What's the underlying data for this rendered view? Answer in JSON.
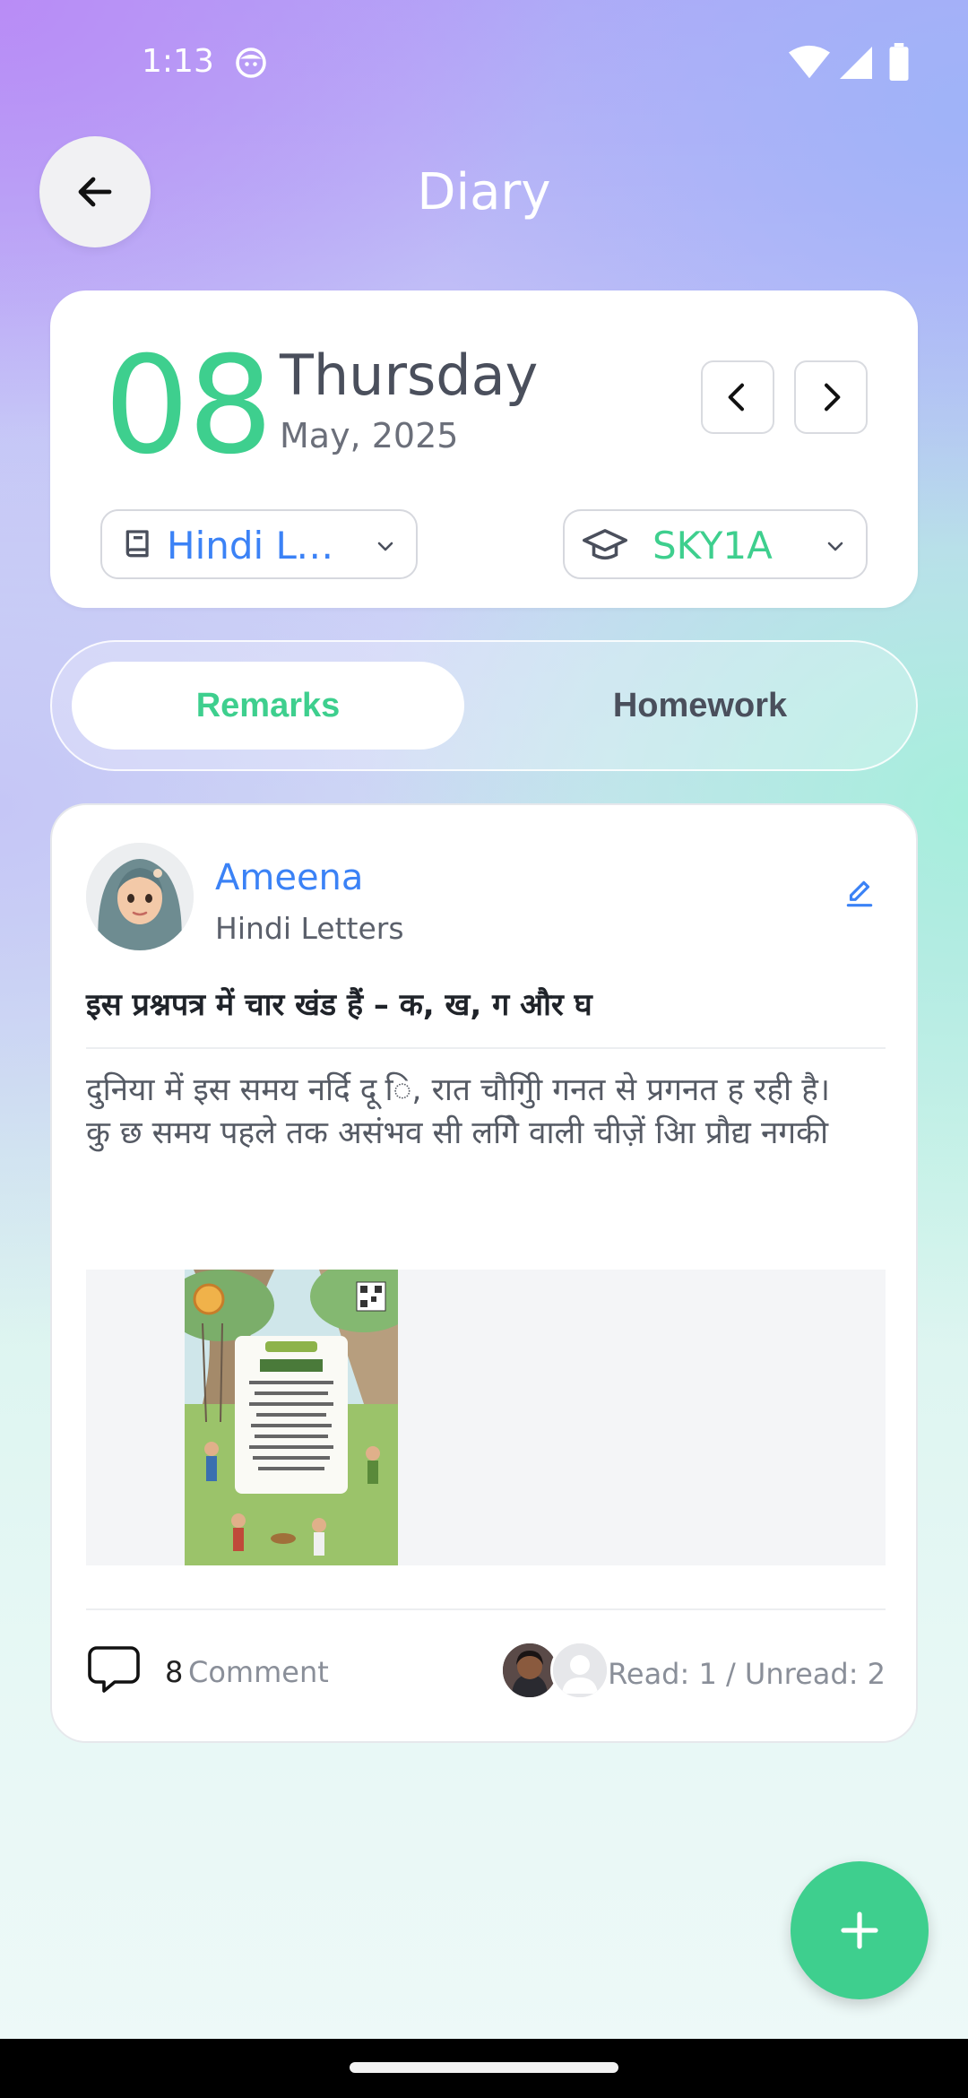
{
  "status_bar": {
    "time": "1:13",
    "icons": [
      "emoji-face-icon",
      "wifi-icon",
      "signal-icon",
      "battery-icon"
    ]
  },
  "header": {
    "title": "Diary",
    "back_icon": "arrow-left-icon"
  },
  "date_card": {
    "day": "08",
    "weekday": "Thursday",
    "month_year": "May, 2025",
    "subject_select": {
      "value": "Hindi Letters",
      "display": "Hindi Let…",
      "icon": "book-icon"
    },
    "class_select": {
      "value": "SKY1A",
      "icon": "graduation-cap-icon"
    }
  },
  "tabs": [
    {
      "label": "Remarks",
      "active": true
    },
    {
      "label": "Homework",
      "active": false
    }
  ],
  "remark": {
    "author": "Ameena",
    "subject": "Hindi Letters",
    "title": "इस प्रश्नपत्र में चार खंड हैं – क, ख, ग और घ",
    "body_lines": [
      "दुनिया में इस समय नर्दि दू ि, रात चौगिुी गनत से प्रगनत ह रही है।",
      "कु छ समय पहले तक असंभव सी लगिे वाली चीज़ें आि प्रौद्य नगकी"
    ],
    "comment_count": "8",
    "comment_label": "Comment",
    "read_status": "Read: 1 / Unread: 2"
  },
  "colors": {
    "accent_green": "#3ecf8e",
    "accent_blue": "#3b82f6",
    "text_dark": "#4a4f5c"
  }
}
